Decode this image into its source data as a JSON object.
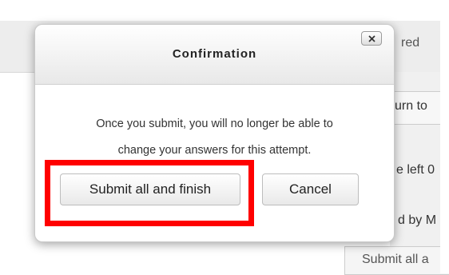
{
  "background": {
    "header_text": "red",
    "return_text": "urn to",
    "time_left_text": "e left 0",
    "by_text": "d by M",
    "submit_text": "Submit all a"
  },
  "dialog": {
    "title": "Confirmation",
    "close_label": "×",
    "message_line1": "Once you submit, you will no longer be able to",
    "message_line2": "change your answers for this attempt.",
    "submit_button": "Submit all and finish",
    "cancel_button": "Cancel"
  },
  "colors": {
    "highlight": "#ff0000"
  },
  "icons": {
    "close": "close-icon"
  }
}
